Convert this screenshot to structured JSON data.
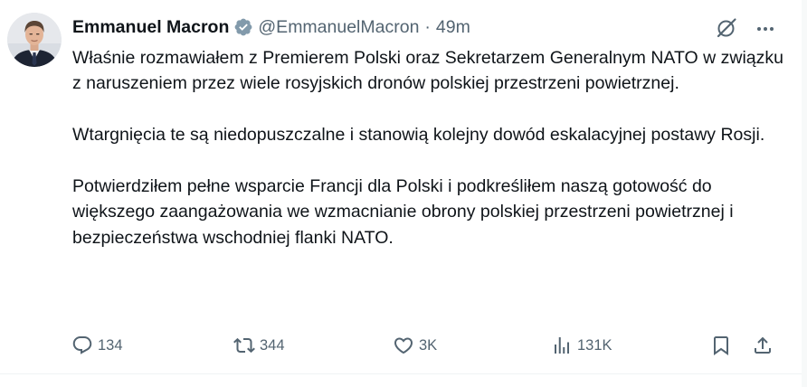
{
  "author": {
    "name": "Emmanuel Macron",
    "handle": "@EmmanuelMacron",
    "separator": "·",
    "time": "49m",
    "verified_badge": "verified-badge-gray"
  },
  "tweet": {
    "paragraphs": [
      "Właśnie rozmawiałem z Premierem Polski oraz Sekretarzem Generalnym NATO w związku z naruszeniem przez wiele rosyjskich dronów polskiej przestrzeni powietrznej.",
      "Wtargnięcia te są niedopuszczalne i stanowią kolejny dowód  eskalacyjnej postawy Rosji.",
      "Potwierdziłem pełne wsparcie Francji dla Polski i podkreśliłem naszą gotowość do większego zaangażowania we wzmacnianie obrony polskiej przestrzeni powietrznej i bezpieczeństwa wschodniej flanki NATO."
    ]
  },
  "actions": {
    "replies": "134",
    "reposts": "344",
    "likes": "3K",
    "views": "131K"
  },
  "icons": [
    "grok-icon",
    "more-icon",
    "reply-icon",
    "repost-icon",
    "like-icon",
    "views-icon",
    "bookmark-icon",
    "share-icon"
  ],
  "colors": {
    "text": "#0f1419",
    "secondary": "#536471",
    "badge": "#829aab",
    "divider": "#eff3f4"
  }
}
